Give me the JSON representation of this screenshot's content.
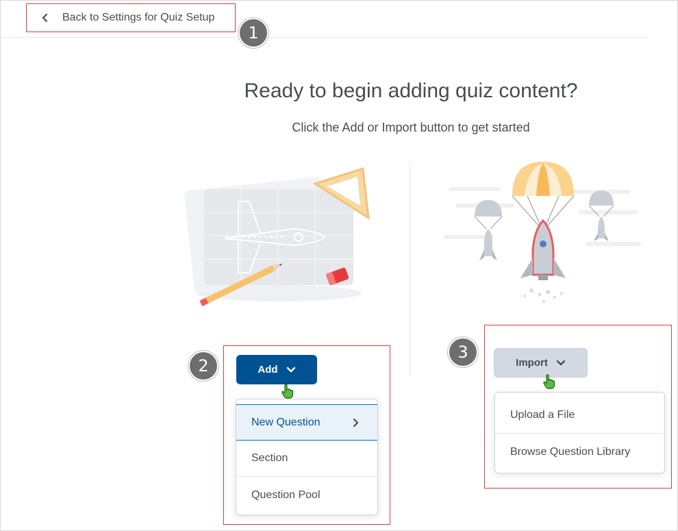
{
  "nav": {
    "back_label": "Back to Settings for Quiz Setup"
  },
  "callouts": [
    "1",
    "2",
    "3"
  ],
  "main": {
    "heading": "Ready to begin adding quiz content?",
    "subheading": "Click the Add or Import button to get started"
  },
  "add": {
    "button_label": "Add",
    "menu_items": [
      {
        "label": "New Question",
        "has_submenu": true
      },
      {
        "label": "Section"
      },
      {
        "label": "Question Pool"
      }
    ]
  },
  "import": {
    "button_label": "Import",
    "menu_items": [
      {
        "label": "Upload a File"
      },
      {
        "label": "Browse Question Library"
      }
    ]
  },
  "colors": {
    "primary": "#005393",
    "annotation_red": "#e0393e",
    "callout_gray": "#6e6e6e",
    "secondary_button": "#d3d9e3",
    "active_item_bg": "#eaf2f9"
  },
  "icons": [
    "chevron-left-icon",
    "chevron-down-icon",
    "chevron-right-icon",
    "hand-pointer-icon"
  ]
}
